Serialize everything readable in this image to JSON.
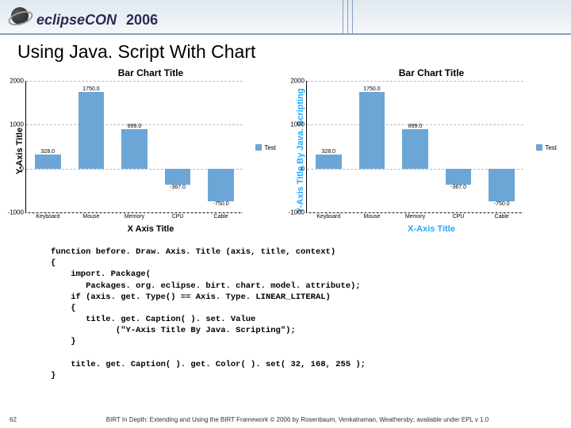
{
  "header": {
    "logo_text": "eclipseCON",
    "year": "2006"
  },
  "title": "Using Java. Script With Chart",
  "chart_data": [
    {
      "type": "bar",
      "title": "Bar Chart Title",
      "xlabel": "X Axis Title",
      "ylabel": "Y-Axis Title",
      "ylim": [
        -1000,
        2000
      ],
      "yticks": [
        2000,
        1000,
        0,
        -1000
      ],
      "categories": [
        "Keyboard",
        "Mouse",
        "Memory",
        "CPU",
        "Cable"
      ],
      "values": [
        328.0,
        1750.0,
        899.0,
        -367.0,
        -750.0
      ],
      "legend": "Test",
      "color": "#6ba6d6"
    },
    {
      "type": "bar",
      "title": "Bar Chart Title",
      "xlabel": "X-Axis Title",
      "ylabel": "Y-Axis Title By Java. Scripting",
      "ylim": [
        -1000,
        2000
      ],
      "yticks": [
        2000,
        1000,
        0,
        -1000
      ],
      "categories": [
        "Keyboard",
        "Mouse",
        "Memory",
        "CPU",
        "Cable"
      ],
      "values": [
        328.0,
        1750.0,
        899.0,
        -367.0,
        -750.0
      ],
      "legend": "Test",
      "color": "#6ba6d6",
      "axis_color": "rgb(32,168,255)"
    }
  ],
  "code": "function before. Draw. Axis. Title (axis, title, context)\n{\n    import. Package(\n       Packages. org. eclipse. birt. chart. model. attribute);\n    if (axis. get. Type() == Axis. Type. LINEAR_LITERAL)\n    {\n       title. get. Caption( ). set. Value\n             (\"Y-Axis Title By Java. Scripting\");\n    }\n\n    title. get. Caption( ). get. Color( ). set( 32, 168, 255 );\n}",
  "footer": {
    "page": "62",
    "text": "BIRT In Depth: Extending and Using the BIRT Framework © 2006 by Rosenbaum, Venkatraman, Weathersby; available under EPL v 1.0"
  }
}
